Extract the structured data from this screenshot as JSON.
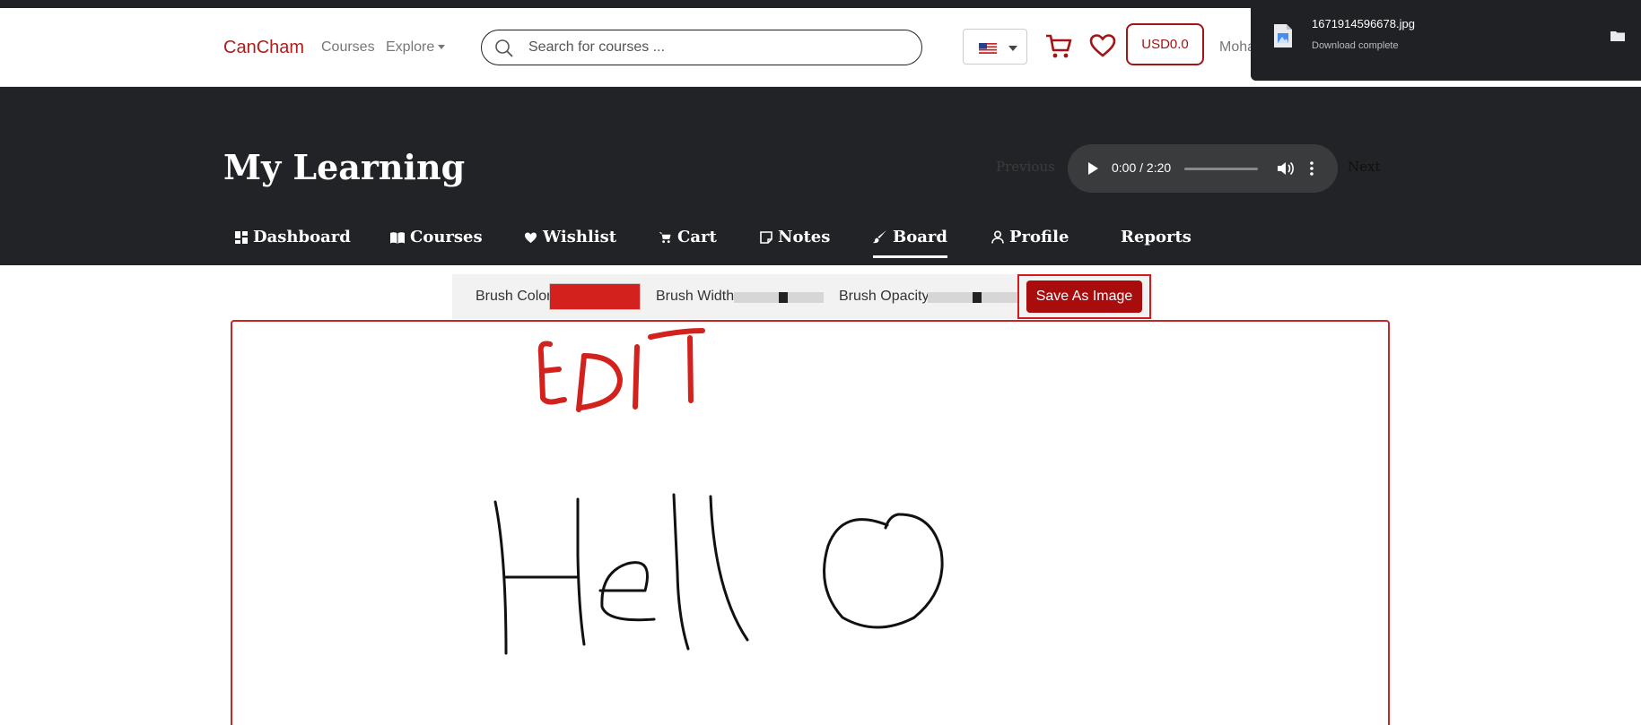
{
  "navbar": {
    "brand": "CanCham",
    "links": {
      "courses": "Courses",
      "explore": "Explore"
    },
    "search_placeholder": "Search for courses ...",
    "currency_button": "USD0.0",
    "user_name": "Moha"
  },
  "hero": {
    "title": "My Learning",
    "prev_label": "Previous",
    "next_label": "Next",
    "audio": {
      "time": "0:00 / 2:20",
      "progress": 0
    }
  },
  "tabs": [
    {
      "label": "Dashboard",
      "icon": "dashboard-icon"
    },
    {
      "label": "Courses",
      "icon": "book-icon"
    },
    {
      "label": "Wishlist",
      "icon": "heart-icon"
    },
    {
      "label": "Cart",
      "icon": "cart-icon"
    },
    {
      "label": "Notes",
      "icon": "note-icon"
    },
    {
      "label": "Board",
      "icon": "brush-icon",
      "active": true
    },
    {
      "label": "Profile",
      "icon": "user-icon"
    },
    {
      "label": "Reports",
      "icon": ""
    }
  ],
  "toolbar": {
    "brush_color_label": "Brush Color",
    "brush_color": "#d3211d",
    "brush_width_label": "Brush Width",
    "brush_width": 0.5,
    "brush_opacity_label": "Brush Opacity",
    "brush_opacity": 0.5,
    "save_label": "Save As Image"
  },
  "board": {
    "drawings": [
      {
        "text": "EDIT",
        "color": "#d3211d"
      },
      {
        "text": "Hello",
        "color": "#000000"
      }
    ]
  },
  "download_toast": {
    "file_name": "1671914596678.jpg",
    "status": "Download complete"
  },
  "colors": {
    "brand": "#b01c1c",
    "hero_bg": "#222326",
    "accent_button": "#a80c0c"
  }
}
